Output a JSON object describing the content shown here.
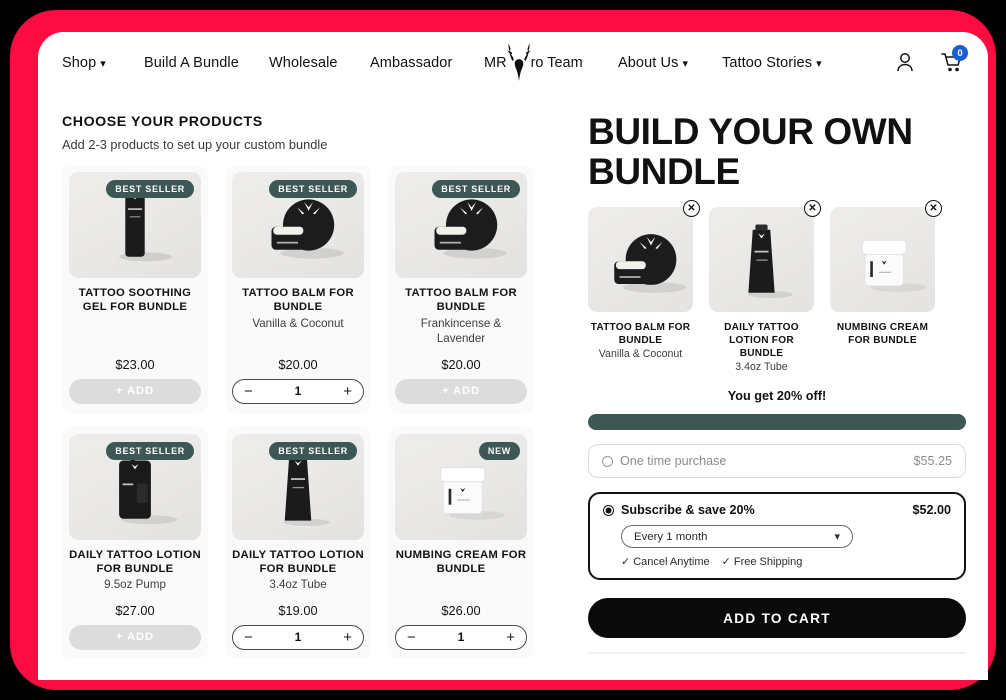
{
  "theme": {
    "frame_color": "#fb0d41",
    "badge_color": "#3d5754",
    "accent_dark": "#0a0a0a",
    "cart_badge_color": "#1a5fd0"
  },
  "nav": {
    "links": [
      {
        "label": "Shop",
        "caret": true
      },
      {
        "label": "Build A Bundle",
        "caret": false
      },
      {
        "label": "Wholesale",
        "caret": false
      },
      {
        "label": "Ambassador",
        "caret": false
      }
    ],
    "logo": {
      "prefix": "MR",
      "suffix": "ro Team",
      "icon": "deer-head-logo"
    },
    "right_links": [
      {
        "label": "About Us",
        "caret": true
      },
      {
        "label": "Tattoo Stories",
        "caret": true
      }
    ],
    "account_icon": "user-icon",
    "cart_icon": "shopping-cart-icon",
    "cart_count": "0"
  },
  "left": {
    "heading": "CHOOSE YOUR PRODUCTS",
    "subheading": "Add 2-3 products to set up your custom bundle",
    "products": [
      {
        "name": "TATTOO SOOTHING GEL FOR BUNDLE",
        "variant": "",
        "price": "$23.00",
        "badge": "BEST SELLER",
        "state": "add",
        "add_label": "+ ADD",
        "qty": "",
        "image": "black-tube-repair-gel"
      },
      {
        "name": "TATTOO BALM FOR BUNDLE",
        "variant": "Vanilla & Coconut",
        "price": "$20.00",
        "badge": "BEST SELLER",
        "state": "qty",
        "add_label": "+ ADD",
        "qty": "1",
        "image": "black-balm-tin"
      },
      {
        "name": "TATTOO BALM FOR BUNDLE",
        "variant": "Frankincense & Lavender",
        "price": "$20.00",
        "badge": "BEST SELLER",
        "state": "add",
        "add_label": "+ ADD",
        "qty": "",
        "image": "black-balm-tin"
      },
      {
        "name": "DAILY TATTOO LOTION FOR BUNDLE",
        "variant": "9.5oz Pump",
        "price": "$27.00",
        "badge": "BEST SELLER",
        "state": "add",
        "add_label": "+ ADD",
        "qty": "",
        "image": "black-pump-bottle"
      },
      {
        "name": "DAILY TATTOO LOTION FOR BUNDLE",
        "variant": "3.4oz Tube",
        "price": "$19.00",
        "badge": "BEST SELLER",
        "state": "qty",
        "add_label": "+ ADD",
        "qty": "1",
        "image": "black-lotion-tube"
      },
      {
        "name": "NUMBING CREAM FOR BUNDLE",
        "variant": "",
        "price": "$26.00",
        "badge": "NEW",
        "state": "qty",
        "add_label": "+ ADD",
        "qty": "1",
        "image": "white-cream-jar"
      }
    ]
  },
  "right": {
    "title": "BUILD YOUR OWN BUNDLE",
    "selected": [
      {
        "name": "TATTOO BALM FOR BUNDLE",
        "variant": "Vanilla & Coconut",
        "remove_icon": "close-circle-icon",
        "image": "black-balm-tin"
      },
      {
        "name": "DAILY TATTOO LOTION FOR BUNDLE",
        "variant": "3.4oz Tube",
        "remove_icon": "close-circle-icon",
        "image": "black-lotion-tube"
      },
      {
        "name": "NUMBING CREAM FOR BUNDLE",
        "variant": "",
        "remove_icon": "close-circle-icon",
        "image": "white-cream-jar"
      }
    ],
    "discount_text": "You get 20% off!",
    "progress_percent": 100,
    "purchase_options": [
      {
        "label": "One time purchase",
        "price": "$55.25",
        "selected": false
      },
      {
        "label": "Subscribe & save 20%",
        "price": "$52.00",
        "selected": true
      }
    ],
    "frequency": "Every 1 month",
    "perks": [
      "Cancel Anytime",
      "Free Shipping"
    ],
    "cta": "ADD TO CART"
  }
}
